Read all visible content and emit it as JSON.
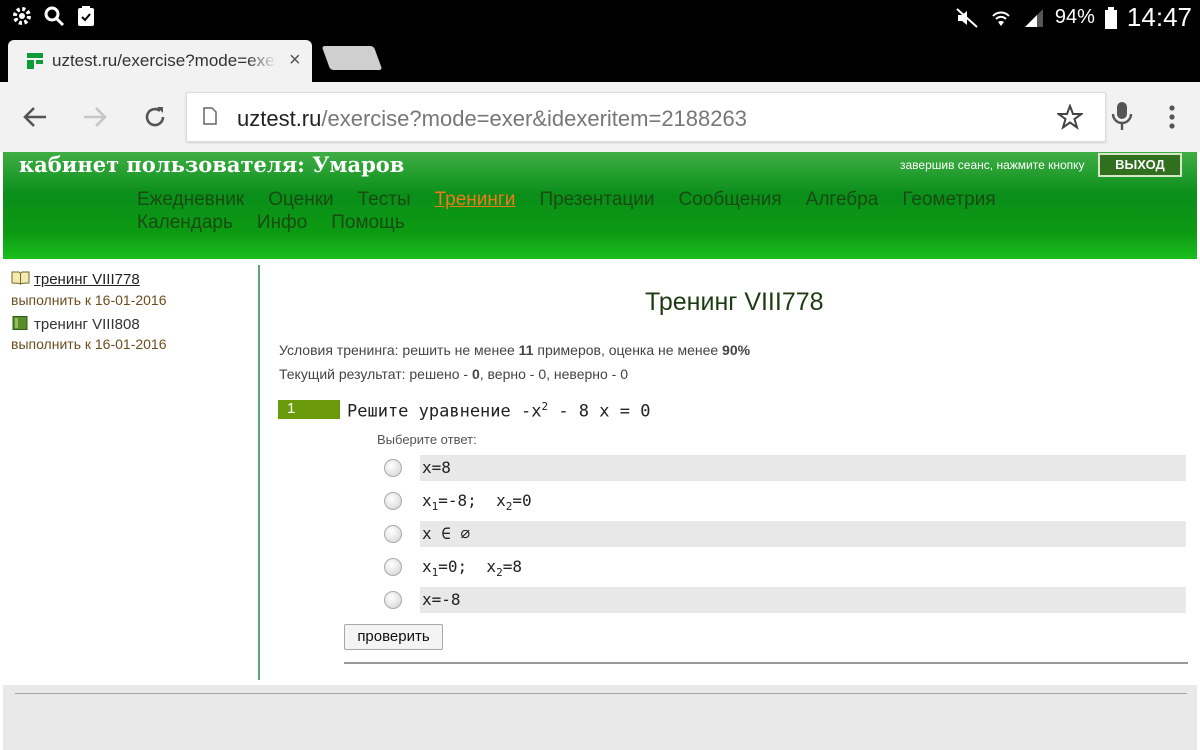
{
  "statusbar": {
    "icons_left": [
      "settings-icon",
      "search-icon",
      "clipboard-icon"
    ],
    "battery": "94%",
    "time": "14:47"
  },
  "tab": {
    "title": "uztest.ru/exercise?mode=exer&idexeritem=2188263",
    "close": "×"
  },
  "omnibox": {
    "host": "uztest.ru",
    "path": "/exercise?mode=exer&idexeritem=2188263"
  },
  "header": {
    "user_title": "кабинет пользователя: Умаров",
    "logout_hint": "завершив сеанс, нажмите кнопку",
    "logout_label": "ВЫХОД",
    "nav": [
      "Ежедневник",
      "Оценки",
      "Тесты",
      "Тренинги",
      "Презентации",
      "Сообщения",
      "Алгебра",
      "Геометрия",
      "Календарь",
      "Инфо",
      "Помощь"
    ]
  },
  "sidebar": {
    "items": [
      {
        "label": "тренинг VIII778",
        "due": "выполнить к 16-01-2016"
      },
      {
        "label": "тренинг VIII808",
        "due": "выполнить к 16-01-2016"
      }
    ]
  },
  "main": {
    "title": "Тренинг VIII778",
    "cond_prefix": "Условия тренинга: решить не менее ",
    "cond_count": "11",
    "cond_mid": " примеров, оценка не менее ",
    "cond_pct": "90%",
    "cur_prefix": "Текущий результат: решено - ",
    "cur_solved": "0",
    "cur_rest": ", верно - 0, неверно - 0",
    "question_number": "1",
    "question_prefix": "Решите уравнение -x",
    "question_exp": "2",
    "question_suffix": " - 8 x = 0",
    "choose_label": "Выберите ответ:",
    "answers": [
      {
        "parts": [
          "x=8"
        ]
      },
      {
        "parts": [
          "x",
          "1",
          "=-8;  x",
          "2",
          "=0"
        ]
      },
      {
        "parts": [
          "x ∈ ∅"
        ]
      },
      {
        "parts": [
          "x",
          "1",
          "=0;  x",
          "2",
          "=8"
        ]
      },
      {
        "parts": [
          "x=-8"
        ]
      }
    ],
    "check_label": "проверить"
  }
}
